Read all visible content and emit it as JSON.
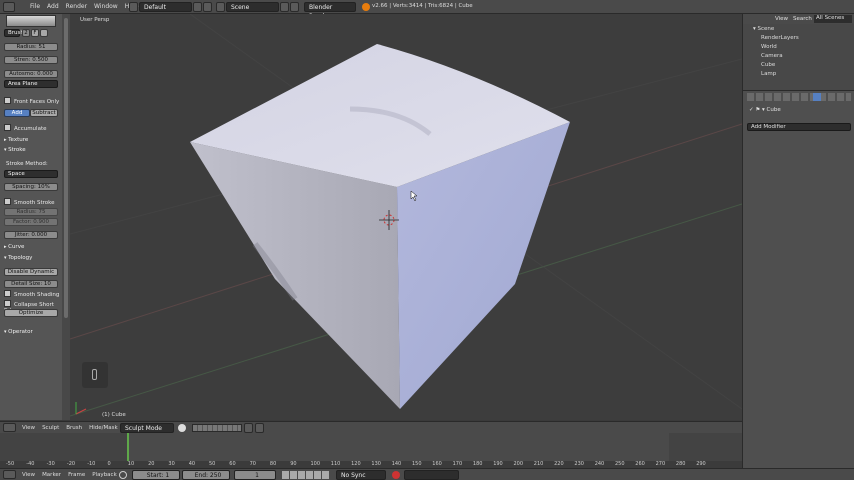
{
  "top_header": {
    "menu": [
      "File",
      "Add",
      "Render",
      "Window",
      "Help"
    ],
    "screen_layout": "Default",
    "scene": "Scene",
    "render_engine": "Blender Render",
    "info": "v2.66 | Verts:3414 | Tris:6824 | Cube"
  },
  "toolshelf": {
    "brush_label": "Brush",
    "brush_index": "2",
    "brush_f": "F",
    "radius": "Radius: 51",
    "strength": "Stren: 0.500",
    "autosmooth": "Autosmo: 0.000",
    "plane": "Area Plane",
    "front_faces_only": "Front Faces Only",
    "add": "Add",
    "subtract": "Subtract",
    "accumulate": "Accumulate",
    "texture": "Texture",
    "stroke": "Stroke",
    "stroke_method": "Stroke Method:",
    "stroke_method_value": "Space",
    "spacing": "Spacing: 10%",
    "smooth_stroke": "Smooth Stroke",
    "radius_smooth": "Radius: 75",
    "factor": "Factor: 0.900",
    "jitter": "Jitter: 0.000",
    "curve": "Curve",
    "topology": "Topology",
    "disable_dynamic": "Disable Dynamic",
    "detail_size": "Detail Size: 10",
    "smooth_shading": "Smooth Shading",
    "collapse_short_edges": "Collapse Short Edge",
    "optimize": "Optimize",
    "operator": "Operator"
  },
  "viewport": {
    "view_name": "User Persp",
    "object_label": "(1) Cube"
  },
  "viewport_header": {
    "menu": [
      "View",
      "Sculpt",
      "Brush",
      "Hide/Mask"
    ],
    "mode": "Sculpt Mode"
  },
  "timeline": {
    "ticks": [
      "-50",
      "-40",
      "-30",
      "-20",
      "-10",
      "0",
      "10",
      "20",
      "30",
      "40",
      "50",
      "60",
      "70",
      "80",
      "90",
      "100",
      "110",
      "120",
      "130",
      "140",
      "150",
      "160",
      "170",
      "180",
      "190",
      "200",
      "210",
      "220",
      "230",
      "240",
      "250",
      "260",
      "270",
      "280",
      "290"
    ],
    "menu": [
      "View",
      "Marker",
      "Frame",
      "Playback"
    ],
    "start": "Start: 1",
    "end": "End: 250",
    "current": "1",
    "sync": "No Sync"
  },
  "outliner": {
    "menu": [
      "View",
      "Search"
    ],
    "filter": "All Scenes",
    "items": [
      "Scene",
      "RenderLayers",
      "World",
      "Camera",
      "Cube",
      "Lamp"
    ]
  },
  "properties": {
    "object": "Cube",
    "add_modifier": "Add Modifier"
  },
  "colors": {
    "cube_top": "#d6d6e6",
    "cube_right": "#a8aed4",
    "cube_left": "#bcbcc8",
    "background": "#3d3d3d",
    "selected_button": "#5680c2"
  }
}
